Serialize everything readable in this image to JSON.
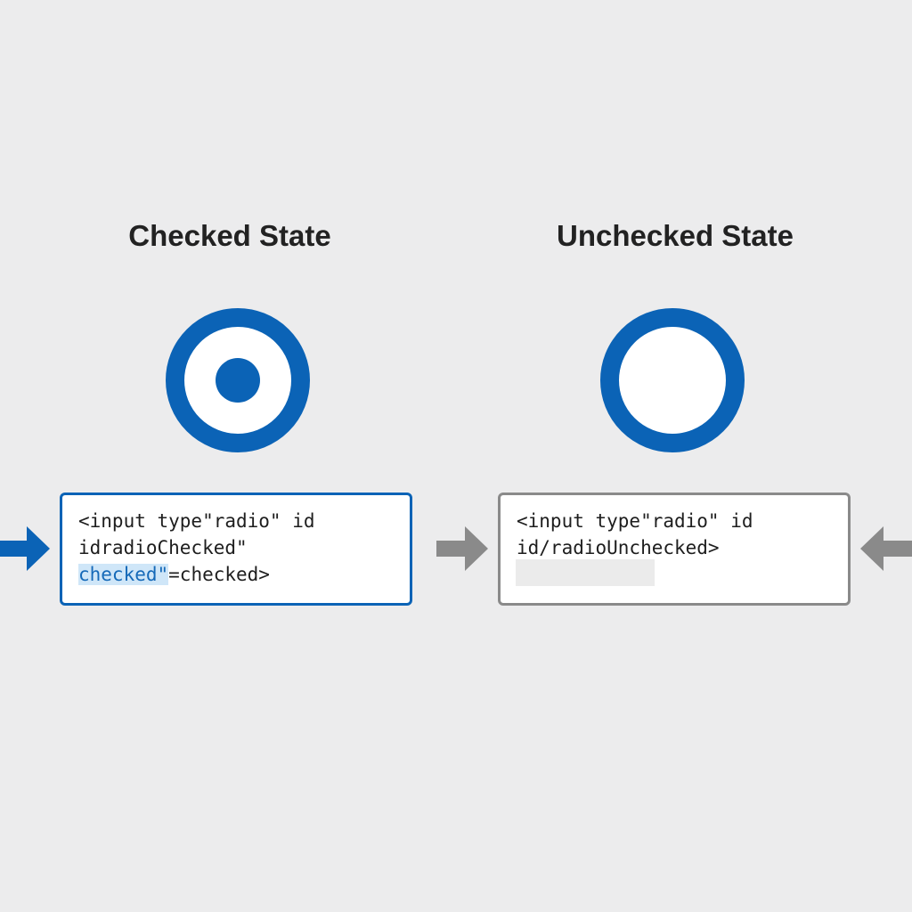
{
  "colors": {
    "background": "#ececed",
    "accent_blue": "#0b63b6",
    "neutral_gray": "#8a8a8a",
    "highlight": "#cfe6f8"
  },
  "checked_panel": {
    "title": "Checked State",
    "radio_state": "checked",
    "code_line_1": "<input type\"radio\" id",
    "code_line_2": "idradioChecked\"",
    "code_line_3_highlight": "checked\"",
    "code_line_3_rest": "=checked>"
  },
  "unchecked_panel": {
    "title": "Unchecked State",
    "radio_state": "unchecked",
    "code_line_1": "<input type\"radio\" id",
    "code_line_2": "id/radioUnchecked>"
  },
  "arrows": [
    {
      "icon": "arrow-right-icon",
      "color": "#0b63b6"
    },
    {
      "icon": "arrow-right-icon",
      "color": "#8a8a8a"
    },
    {
      "icon": "arrow-left-icon",
      "color": "#8a8a8a"
    }
  ]
}
